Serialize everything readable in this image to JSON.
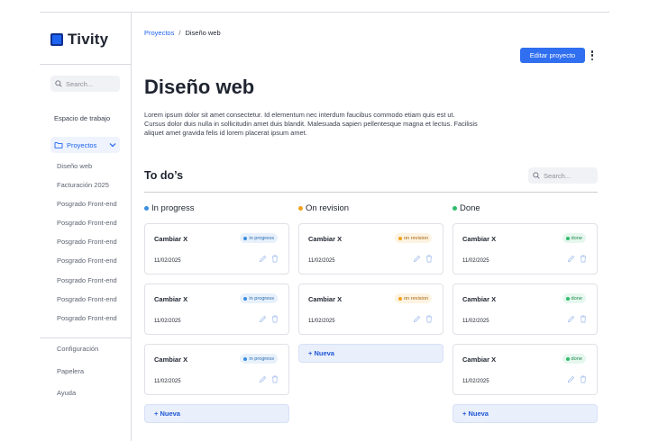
{
  "app": {
    "name": "Tivity"
  },
  "colors": {
    "accent": "#1e63f0",
    "in_progress": "#3b8ee0",
    "on_revision": "#f0a21c",
    "done": "#2dbd6a"
  },
  "sidebar": {
    "search_placeholder": "Search...",
    "workspace_label": "Espacio de trabajo",
    "projects_label": "Proyectos",
    "projects": [
      {
        "label": "Diseño web"
      },
      {
        "label": "Facturación 2025"
      },
      {
        "label": "Posgrado Front-end"
      },
      {
        "label": "Posgrado Front-end"
      },
      {
        "label": "Posgrado Front-end"
      },
      {
        "label": "Posgrado Front-end"
      },
      {
        "label": "Posgrado Front-end"
      },
      {
        "label": "Posgrado Front-end"
      },
      {
        "label": "Posgrado Front-end"
      }
    ],
    "bottom": [
      {
        "label": "Configuración"
      },
      {
        "label": "Papelera"
      },
      {
        "label": "Ayuda"
      }
    ]
  },
  "header": {
    "breadcrumb": {
      "parent": "Proyectos",
      "separator": "/",
      "current": "Diseño web"
    },
    "edit_button": "Editar proyecto"
  },
  "project": {
    "title": "Diseño web",
    "description": "Lorem ipsum dolor sit amet consectetur. Id elementum nec interdum faucibus commodo etiam quis est ut. Cursus dolor duis nulla in sollicitudin amet duis blandit. Malesuada sapien pellentesque magna et lectus. Facilisis aliquet amet gravida felis id lorem placerat ipsum amet."
  },
  "todos": {
    "title": "To do’s",
    "search_placeholder": "Search...",
    "new_label": "+ Nueva",
    "columns": [
      {
        "name": "In progress",
        "status": "in progress",
        "cards": [
          {
            "title": "Cambiar X",
            "date": "11/02/2025"
          },
          {
            "title": "Cambiar X",
            "date": "11/02/2025"
          },
          {
            "title": "Cambiar X",
            "date": "11/02/2025"
          }
        ]
      },
      {
        "name": "On revision",
        "status": "on revision",
        "cards": [
          {
            "title": "Cambiar X",
            "date": "11/02/2025"
          },
          {
            "title": "Cambiar X",
            "date": "11/02/2025"
          }
        ]
      },
      {
        "name": "Done",
        "status": "done",
        "cards": [
          {
            "title": "Cambiar X",
            "date": "11/02/2025"
          },
          {
            "title": "Cambiar X",
            "date": "11/02/2025"
          },
          {
            "title": "Cambiar X",
            "date": "11/02/2025"
          }
        ]
      }
    ]
  }
}
